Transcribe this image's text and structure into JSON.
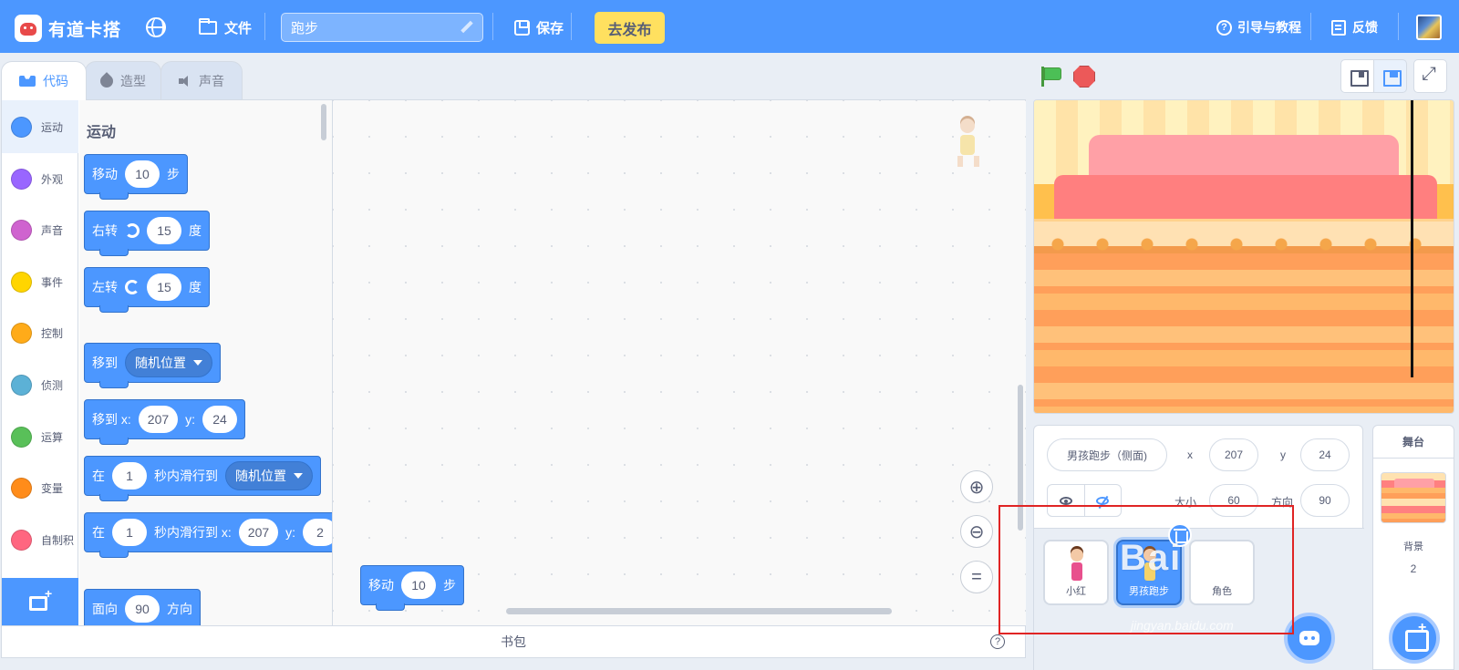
{
  "menubar": {
    "brand": "有道卡搭",
    "file_label": "文件",
    "project_title": "跑步",
    "save_label": "保存",
    "publish_label": "去发布",
    "guide_label": "引导与教程",
    "feedback_label": "反馈"
  },
  "tabs": [
    {
      "label": "代码",
      "active": true,
      "icon": "code-icon"
    },
    {
      "label": "造型",
      "active": false,
      "icon": "brush-icon"
    },
    {
      "label": "声音",
      "active": false,
      "icon": "speaker-icon"
    }
  ],
  "categories": [
    {
      "label": "运动",
      "color": "#4c97ff",
      "active": true
    },
    {
      "label": "外观",
      "color": "#9966ff",
      "active": false
    },
    {
      "label": "声音",
      "color": "#cf63cf",
      "active": false
    },
    {
      "label": "事件",
      "color": "#ffd500",
      "active": false
    },
    {
      "label": "控制",
      "color": "#ffab19",
      "active": false
    },
    {
      "label": "侦测",
      "color": "#5cb1d6",
      "active": false
    },
    {
      "label": "运算",
      "color": "#59c059",
      "active": false
    },
    {
      "label": "变量",
      "color": "#ff8c1a",
      "active": false
    },
    {
      "label": "自制积",
      "color": "#ff6680",
      "active": false
    }
  ],
  "palette": {
    "heading": "运动",
    "blocks": {
      "move": {
        "prefix": "移动",
        "steps": "10",
        "suffix": "步"
      },
      "turn_right": {
        "prefix": "右转",
        "degrees": "15",
        "suffix": "度"
      },
      "turn_left": {
        "prefix": "左转",
        "degrees": "15",
        "suffix": "度"
      },
      "goto": {
        "prefix": "移到",
        "target": "随机位置"
      },
      "goto_xy": {
        "prefix": "移到 x:",
        "x": "207",
        "y_label": "y:",
        "y": "24"
      },
      "glide": {
        "prefix": "在",
        "secs": "1",
        "mid": "秒内滑行到",
        "target": "随机位置"
      },
      "glide_xy": {
        "prefix": "在",
        "secs": "1",
        "mid": "秒内滑行到 x:",
        "x": "207",
        "y_label": "y:",
        "y": "2"
      },
      "point": {
        "prefix": "面向",
        "degrees": "90",
        "suffix": "方向"
      }
    }
  },
  "scripts": {
    "move_block": {
      "prefix": "移动",
      "steps": "10",
      "suffix": "步"
    }
  },
  "backpack": {
    "label": "书包",
    "help": "?"
  },
  "sprite_info": {
    "name": "男孩跑步（侧面)",
    "x_label": "x",
    "x": "207",
    "y_label": "y",
    "y": "24",
    "size_label": "大小",
    "size": "60",
    "direction_label": "方向",
    "direction": "90"
  },
  "sprites": [
    {
      "name": "小红",
      "selected": false
    },
    {
      "name": "男孩跑步",
      "selected": true
    },
    {
      "name": "角色",
      "selected": false
    }
  ],
  "stage_selector": {
    "title": "舞台",
    "backdrop_label": "背景",
    "backdrop_count": "2"
  },
  "overlay": {
    "watermark": "Bai",
    "watermark_sub": "jingyan.baidu.com"
  },
  "colors": {
    "accent": "#4c97ff",
    "publish": "#ffe05f",
    "highlight": "#e02424"
  }
}
